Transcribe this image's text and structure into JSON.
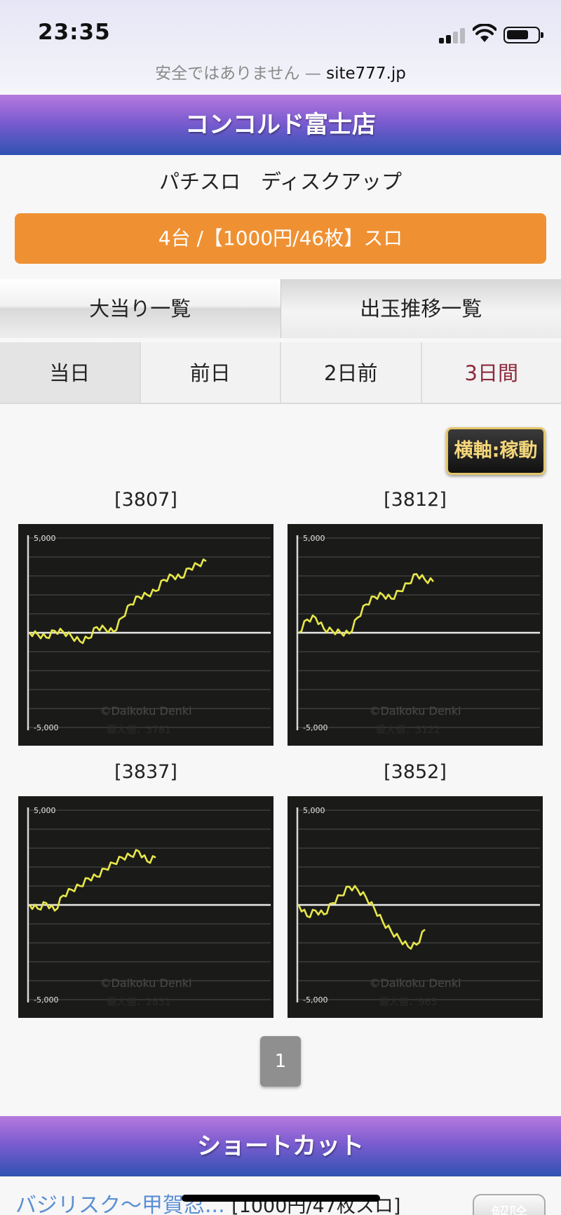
{
  "status": {
    "time": "23:35"
  },
  "address_bar": {
    "warning": "安全ではありません",
    "separator": " — ",
    "domain": "site777.jp"
  },
  "header": {
    "store_name": "コンコルド富士店"
  },
  "machine": {
    "name": "パチスロ　ディスクアップ"
  },
  "summary": {
    "label": "4台 /【1000円/46枚】スロ"
  },
  "tabs": [
    {
      "label": "大当り一覧"
    },
    {
      "label": "出玉推移一覧"
    }
  ],
  "days": [
    {
      "label": "当日"
    },
    {
      "label": "前日"
    },
    {
      "label": "2日前"
    },
    {
      "label": "3日間"
    }
  ],
  "axis_button": {
    "label": "横軸:稼動"
  },
  "charts": [
    {
      "unit": "[3807]",
      "max_label": "最大値：3781",
      "watermark": "©Daikoku Denki",
      "y_top": "5,000",
      "y_bottom": "-5,000",
      "points": [
        0,
        -100,
        -250,
        100,
        50,
        -200,
        -450,
        -300,
        300,
        200,
        50,
        800,
        1500,
        1900,
        2000,
        2200,
        2800,
        3000,
        2900,
        3400,
        3600,
        3781
      ]
    },
    {
      "unit": "[3812]",
      "max_label": "最大値：3122",
      "watermark": "©Daikoku Denki",
      "y_top": "5,000",
      "y_bottom": "-5,000",
      "points": [
        0,
        700,
        800,
        200,
        100,
        0,
        -50,
        800,
        1500,
        1900,
        2000,
        1800,
        2200,
        2600,
        3100,
        2800,
        2700
      ]
    },
    {
      "unit": "[3837]",
      "max_label": "最大値：2831",
      "watermark": "©Daikoku Denki",
      "y_top": "5,000",
      "y_bottom": "-5,000",
      "points": [
        0,
        -200,
        100,
        -300,
        500,
        800,
        1000,
        1400,
        1500,
        1900,
        2200,
        2500,
        2600,
        2831,
        2300,
        2500
      ]
    },
    {
      "unit": "[3852]",
      "max_label": "最大値：965",
      "watermark": "©Daikoku Denki",
      "y_top": "5,000",
      "y_bottom": "-5,000",
      "points": [
        0,
        -600,
        -300,
        -500,
        100,
        500,
        965,
        800,
        400,
        -200,
        -900,
        -1400,
        -1800,
        -2200,
        -2100,
        -1300
      ]
    }
  ],
  "chart_data": [
    {
      "type": "line",
      "title": "[3807]",
      "ylim": [
        -5000,
        5000
      ],
      "series": [
        {
          "values": [
            0,
            -100,
            -250,
            100,
            50,
            -200,
            -450,
            -300,
            300,
            200,
            50,
            800,
            1500,
            1900,
            2000,
            2200,
            2800,
            3000,
            2900,
            3400,
            3600,
            3781
          ]
        }
      ]
    },
    {
      "type": "line",
      "title": "[3812]",
      "ylim": [
        -5000,
        5000
      ],
      "series": [
        {
          "values": [
            0,
            700,
            800,
            200,
            100,
            0,
            -50,
            800,
            1500,
            1900,
            2000,
            1800,
            2200,
            2600,
            3100,
            2800,
            2700
          ]
        }
      ]
    },
    {
      "type": "line",
      "title": "[3837]",
      "ylim": [
        -5000,
        5000
      ],
      "series": [
        {
          "values": [
            0,
            -200,
            100,
            -300,
            500,
            800,
            1000,
            1400,
            1500,
            1900,
            2200,
            2500,
            2600,
            2831,
            2300,
            2500
          ]
        }
      ]
    },
    {
      "type": "line",
      "title": "[3852]",
      "ylim": [
        -5000,
        5000
      ],
      "series": [
        {
          "values": [
            0,
            -600,
            -300,
            -500,
            100,
            500,
            965,
            800,
            400,
            -200,
            -900,
            -1400,
            -1800,
            -2200,
            -2100,
            -1300
          ]
        }
      ]
    }
  ],
  "pager": {
    "current": "1"
  },
  "footer": {
    "title": "ショートカット",
    "link_text": "バジリスク～甲賀忍...",
    "link_tag": "[1000円/47枚スロ]",
    "remove_label": "解除"
  },
  "colors": {
    "accent_orange": "#ef9133",
    "header_top": "#b679de",
    "header_bottom": "#2f52b2",
    "chart_line": "#e8e64a",
    "selected_day": "#8e2a3e"
  }
}
